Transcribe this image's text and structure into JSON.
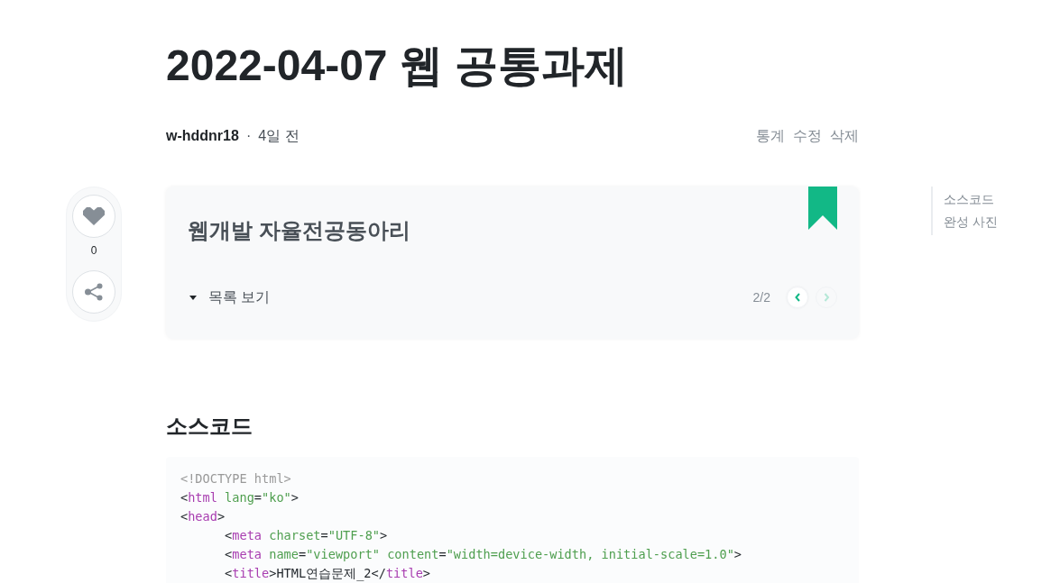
{
  "post": {
    "title": "2022-04-07 웹 공통과제",
    "author": "w-hddnr18",
    "separator": "·",
    "date": "4일 전",
    "actions": [
      "통계",
      "수정",
      "삭제"
    ]
  },
  "like_panel": {
    "liked": false,
    "count": "0"
  },
  "series": {
    "name": "웹개발 자율전공동아리",
    "toggle_label": "목록 보기",
    "position": "2/2",
    "nav": [
      {
        "kind": "prev",
        "disabled": false
      },
      {
        "kind": "next",
        "disabled": true
      }
    ]
  },
  "toc": [
    {
      "label": "소스코드"
    },
    {
      "label": "완성 사진"
    }
  ],
  "content": {
    "heading": "소스코드",
    "code_lines": [
      [
        {
          "kind": "doctype",
          "text": "<!DOCTYPE html>"
        }
      ],
      [
        {
          "kind": "punct",
          "text": "<"
        },
        {
          "kind": "tag",
          "text": "html"
        },
        {
          "kind": "attr",
          "text": " lang"
        },
        {
          "kind": "punct",
          "text": "="
        },
        {
          "kind": "string",
          "text": "\"ko\""
        },
        {
          "kind": "punct",
          "text": ">"
        }
      ],
      [
        {
          "kind": "punct",
          "text": "<"
        },
        {
          "kind": "tag",
          "text": "head"
        },
        {
          "kind": "punct",
          "text": ">"
        }
      ],
      [
        {
          "kind": "punct",
          "text": "\t<"
        },
        {
          "kind": "tag",
          "text": "meta"
        },
        {
          "kind": "attr",
          "text": " charset"
        },
        {
          "kind": "punct",
          "text": "="
        },
        {
          "kind": "string",
          "text": "\"UTF-8\""
        },
        {
          "kind": "punct",
          "text": ">"
        }
      ],
      [
        {
          "kind": "punct",
          "text": "\t<"
        },
        {
          "kind": "tag",
          "text": "meta"
        },
        {
          "kind": "attr",
          "text": " name"
        },
        {
          "kind": "punct",
          "text": "="
        },
        {
          "kind": "string",
          "text": "\"viewport\""
        },
        {
          "kind": "attr",
          "text": " content"
        },
        {
          "kind": "punct",
          "text": "="
        },
        {
          "kind": "string",
          "text": "\"width=device-width, initial-scale=1.0\""
        },
        {
          "kind": "punct",
          "text": ">"
        }
      ],
      [
        {
          "kind": "punct",
          "text": "\t<"
        },
        {
          "kind": "tag",
          "text": "title"
        },
        {
          "kind": "punct",
          "text": ">"
        },
        {
          "kind": "text",
          "text": "HTML연습문제_2"
        },
        {
          "kind": "punct",
          "text": "</"
        },
        {
          "kind": "tag",
          "text": "title"
        },
        {
          "kind": "punct",
          "text": ">"
        }
      ]
    ]
  }
}
